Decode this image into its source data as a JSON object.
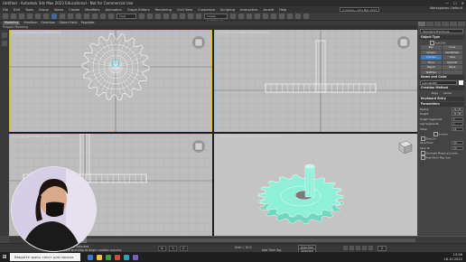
{
  "window": {
    "title": "Untitled - Autodesk 3ds Max 2023 Educational - Not for Commercial Use",
    "controls": [
      "—",
      "☐",
      "✕"
    ]
  },
  "menu": {
    "items": [
      "File",
      "Edit",
      "Tools",
      "Group",
      "Views",
      "Create",
      "Modifiers",
      "Animation",
      "Graph Editors",
      "Rendering",
      "Civil View",
      "Customize",
      "Scripting",
      "Interactive",
      "Arnold",
      "Help"
    ],
    "workspace_box": "C:\\Users\\...\\3ds Max 2023 Edu...",
    "workspaces": "Workspaces: Default"
  },
  "toolbar": {
    "view_combo": "View",
    "selset_combo": "Create Selection Se"
  },
  "ribbon": {
    "tabs": [
      "Modeling",
      "Freeform",
      "Selection",
      "Object Paint",
      "Populate"
    ],
    "active_index": 0,
    "subtitle": "Polygon Modeling"
  },
  "viewports": {
    "top": {
      "label": "[+] [Top] [Standard] [Wireframe]"
    },
    "front": {
      "label": "[+] [Front] [Standard] [Wireframe]"
    },
    "left": {
      "label": "[+] [Left] [Standard] [Wireframe]"
    },
    "perspective": {
      "label": "[+] [Perspective] [Standard] [Edged Faces]"
    }
  },
  "command_panel": {
    "category": "Standard Primitives",
    "object_type_title": "Object Type",
    "autogrid": "AutoGrid",
    "buttons": [
      "Box",
      "Cone",
      "Sphere",
      "GeoSphere",
      "Cylinder",
      "Tube",
      "Torus",
      "Pyramid",
      "Teapot",
      "Plane",
      "TextPlus",
      ""
    ],
    "selected_button": 4,
    "name_color_title": "Name and Color",
    "name_value": "Cylinder002",
    "creation_method_title": "Creation Method",
    "creation_options": [
      "Edge",
      "Center"
    ],
    "keyboard_entry_title": "Keyboard Entry",
    "parameters_title": "Parameters",
    "params": [
      {
        "label": "Radius:",
        "value": "26,185"
      },
      {
        "label": "Height:",
        "value": "35,399"
      },
      {
        "label": "Height Segments:",
        "value": "5"
      },
      {
        "label": "Cap Segments:",
        "value": "1"
      },
      {
        "label": "Sides:",
        "value": "18"
      }
    ],
    "smooth": "Smooth",
    "slice_on": "Slice On",
    "slice_from": {
      "label": "Slice From:",
      "value": "0,0"
    },
    "slice_to": {
      "label": "Slice To:",
      "value": "0,0"
    },
    "gen_mapping": "Generate Mapping Coords.",
    "real_world": "Real-World Map Size"
  },
  "timeline": {
    "frame_label": "0 / 100"
  },
  "status": {
    "line1": "1 Object Selected",
    "line2": "Click and drag to begin creation process",
    "coords": [
      "X: ",
      "Y: ",
      "Z: "
    ],
    "grid": "Grid = 10,0",
    "add_time_tag": "Add Time Tag",
    "auto_key": "Auto Key",
    "selected": "Selected",
    "frame_value": "0"
  },
  "taskbar": {
    "search_placeholder": "Введите здесь текст для поиска",
    "time": "13:56",
    "date": "18.10.2022"
  },
  "colors": {
    "viewport_bg": "#bdbdbd",
    "gear_fill": "#8ef0d6",
    "gear_wire": "#ffffff",
    "active_border": "#e8c400",
    "selected_button": "#3d7ab8"
  }
}
